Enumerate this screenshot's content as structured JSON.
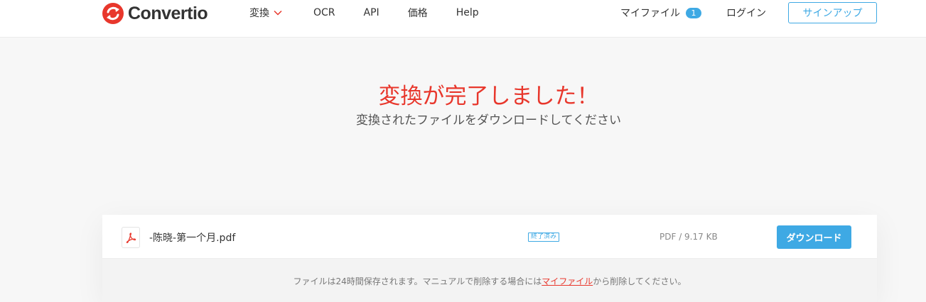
{
  "brand": {
    "name": "Convertio",
    "accent": "#e8372c",
    "primary": "#3ea9e4"
  },
  "nav": {
    "convert_label": "変換",
    "ocr_label": "OCR",
    "api_label": "API",
    "price_label": "価格",
    "help_label": "Help"
  },
  "account": {
    "myfiles_label": "マイファイル",
    "myfiles_count": "1",
    "login_label": "ログイン",
    "signup_label": "サインアップ"
  },
  "hero": {
    "title": "変換が完了しました！",
    "subtitle": "変換されたファイルをダウンロードしてください"
  },
  "file": {
    "icon": "pdf-icon",
    "name": "-陈晓-第一个月.pdf",
    "status": "終了済み",
    "size": "PDF / 9.17 KB",
    "download_label": "ダウンロード"
  },
  "note": {
    "before": "ファイルは24時間保存されます。マニュアルで削除する場合には",
    "link": "マイファイル",
    "after": "から削除してください。"
  }
}
